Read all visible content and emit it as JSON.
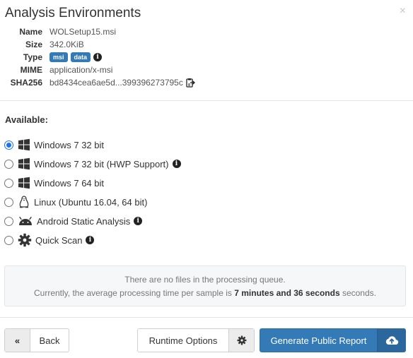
{
  "modal": {
    "title": "Analysis Environments",
    "close_glyph": "×"
  },
  "file": {
    "rows": [
      {
        "key": "Name",
        "value": "WOLSetup15.msi"
      },
      {
        "key": "Size",
        "value": "342.0KiB"
      },
      {
        "key": "Type",
        "badges": [
          "msi",
          "data"
        ]
      },
      {
        "key": "MIME",
        "value": "application/x-msi"
      },
      {
        "key": "SHA256",
        "value": "bd8434cea6ae5d...399396273795c"
      }
    ]
  },
  "environments": {
    "label": "Available:",
    "items": [
      {
        "label": "Windows 7 32 bit",
        "icon": "windows-icon",
        "checked": true,
        "info": false
      },
      {
        "label": "Windows 7 32 bit (HWP Support)",
        "icon": "windows-icon",
        "checked": false,
        "info": true
      },
      {
        "label": "Windows 7 64 bit",
        "icon": "windows-icon",
        "checked": false,
        "info": false
      },
      {
        "label": "Linux (Ubuntu 16.04, 64 bit)",
        "icon": "linux-icon",
        "checked": false,
        "info": false
      },
      {
        "label": "Android Static Analysis",
        "icon": "android-icon",
        "checked": false,
        "info": true
      },
      {
        "label": "Quick Scan",
        "icon": "gear-icon",
        "checked": false,
        "info": true
      }
    ]
  },
  "queue": {
    "line1": "There are no files in the processing queue.",
    "line2_prefix": "Currently, the average processing time per sample is ",
    "line2_bold": "7 minutes and 36 seconds",
    "line2_suffix": " seconds."
  },
  "footer": {
    "back_label": "Back",
    "back_icon_glyph": "«",
    "runtime_label": "Runtime Options",
    "report_label": "Generate Public Report"
  },
  "colors": {
    "primary": "#337ab7",
    "radio_checked": "#1a73e8"
  }
}
